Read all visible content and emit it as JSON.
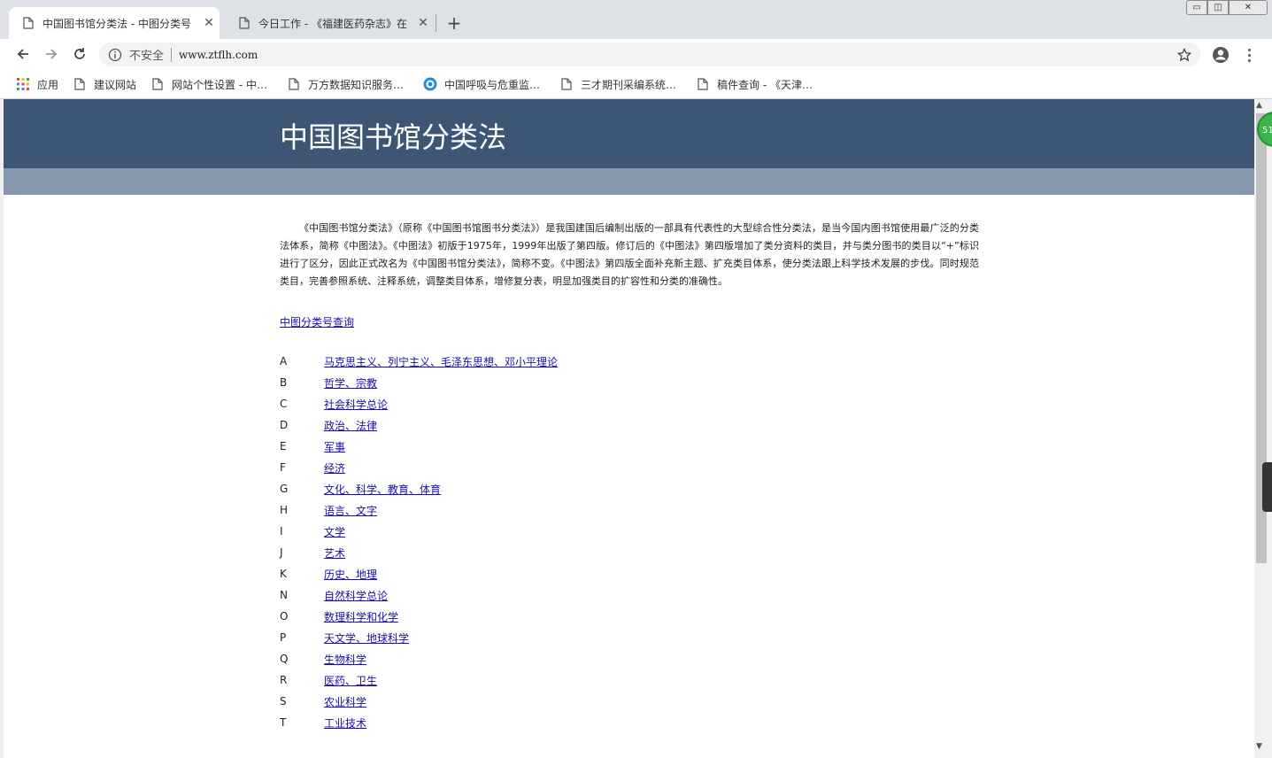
{
  "browser": {
    "tabs": [
      {
        "title": "中国图书馆分类法 - 中图分类号",
        "active": true
      },
      {
        "title": "今日工作 - 《福建医药杂志》在",
        "active": false
      }
    ],
    "new_tab": "+",
    "window_controls": {
      "minimize": "▭",
      "maximize": "◫",
      "close": "✕"
    },
    "address": {
      "security": "不安全",
      "url": "www.ztflh.com"
    },
    "bookmarks": [
      {
        "label": "应用",
        "icon": "apps-grid-icon"
      },
      {
        "label": "建议网站",
        "icon": "page-icon"
      },
      {
        "label": "网站个性设置 - 中…",
        "icon": "page-icon"
      },
      {
        "label": "万方数据知识服务…",
        "icon": "page-icon"
      },
      {
        "label": "中国呼吸与危重监…",
        "icon": "globe-logo-icon"
      },
      {
        "label": "三才期刊采编系统…",
        "icon": "page-icon"
      },
      {
        "label": "稿件查询 - 《天津…",
        "icon": "page-icon"
      }
    ]
  },
  "page": {
    "title": "中国图书馆分类法",
    "intro": "《中国图书馆分类法》（原称《中国图书馆图书分类法》）是我国建国后编制出版的一部具有代表性的大型综合性分类法，是当今国内图书馆使用最广泛的分类法体系，简称《中图法》。《中图法》初版于1975年，1999年出版了第四版。修订后的《中图法》第四版增加了类分资料的类目，并与类分图书的类目以“+”标识进行了区分，因此正式改名为《中国图书馆分类法》，简称不变。《中图法》第四版全面补充新主题、扩充类目体系，使分类法跟上科学技术发展的步伐。同时规范类目，完善参照系统、注释系统，调整类目体系，增修复分表，明显加强类目的扩容性和分类的准确性。",
    "query_link": "中图分类号查询",
    "categories": [
      {
        "code": "A",
        "name": "马克思主义、列宁主义、毛泽东思想、邓小平理论"
      },
      {
        "code": "B",
        "name": "哲学、宗教"
      },
      {
        "code": "C",
        "name": "社会科学总论"
      },
      {
        "code": "D",
        "name": "政治、法律"
      },
      {
        "code": "E",
        "name": "军事"
      },
      {
        "code": "F",
        "name": "经济"
      },
      {
        "code": "G",
        "name": "文化、科学、教育、体育"
      },
      {
        "code": "H",
        "name": "语言、文字"
      },
      {
        "code": "I",
        "name": "文学"
      },
      {
        "code": "J",
        "name": "艺术"
      },
      {
        "code": "K",
        "name": "历史、地理"
      },
      {
        "code": "N",
        "name": "自然科学总论"
      },
      {
        "code": "O",
        "name": "数理科学和化学"
      },
      {
        "code": "P",
        "name": "天文学、地球科学"
      },
      {
        "code": "Q",
        "name": "生物科学"
      },
      {
        "code": "R",
        "name": "医药、卫生"
      },
      {
        "code": "S",
        "name": "农业科学"
      },
      {
        "code": "T",
        "name": "工业技术"
      }
    ]
  },
  "overlay": {
    "badge": "51"
  },
  "colors": {
    "header": "#3e5676",
    "subband": "#8797ad",
    "link": "#1a0dab"
  }
}
